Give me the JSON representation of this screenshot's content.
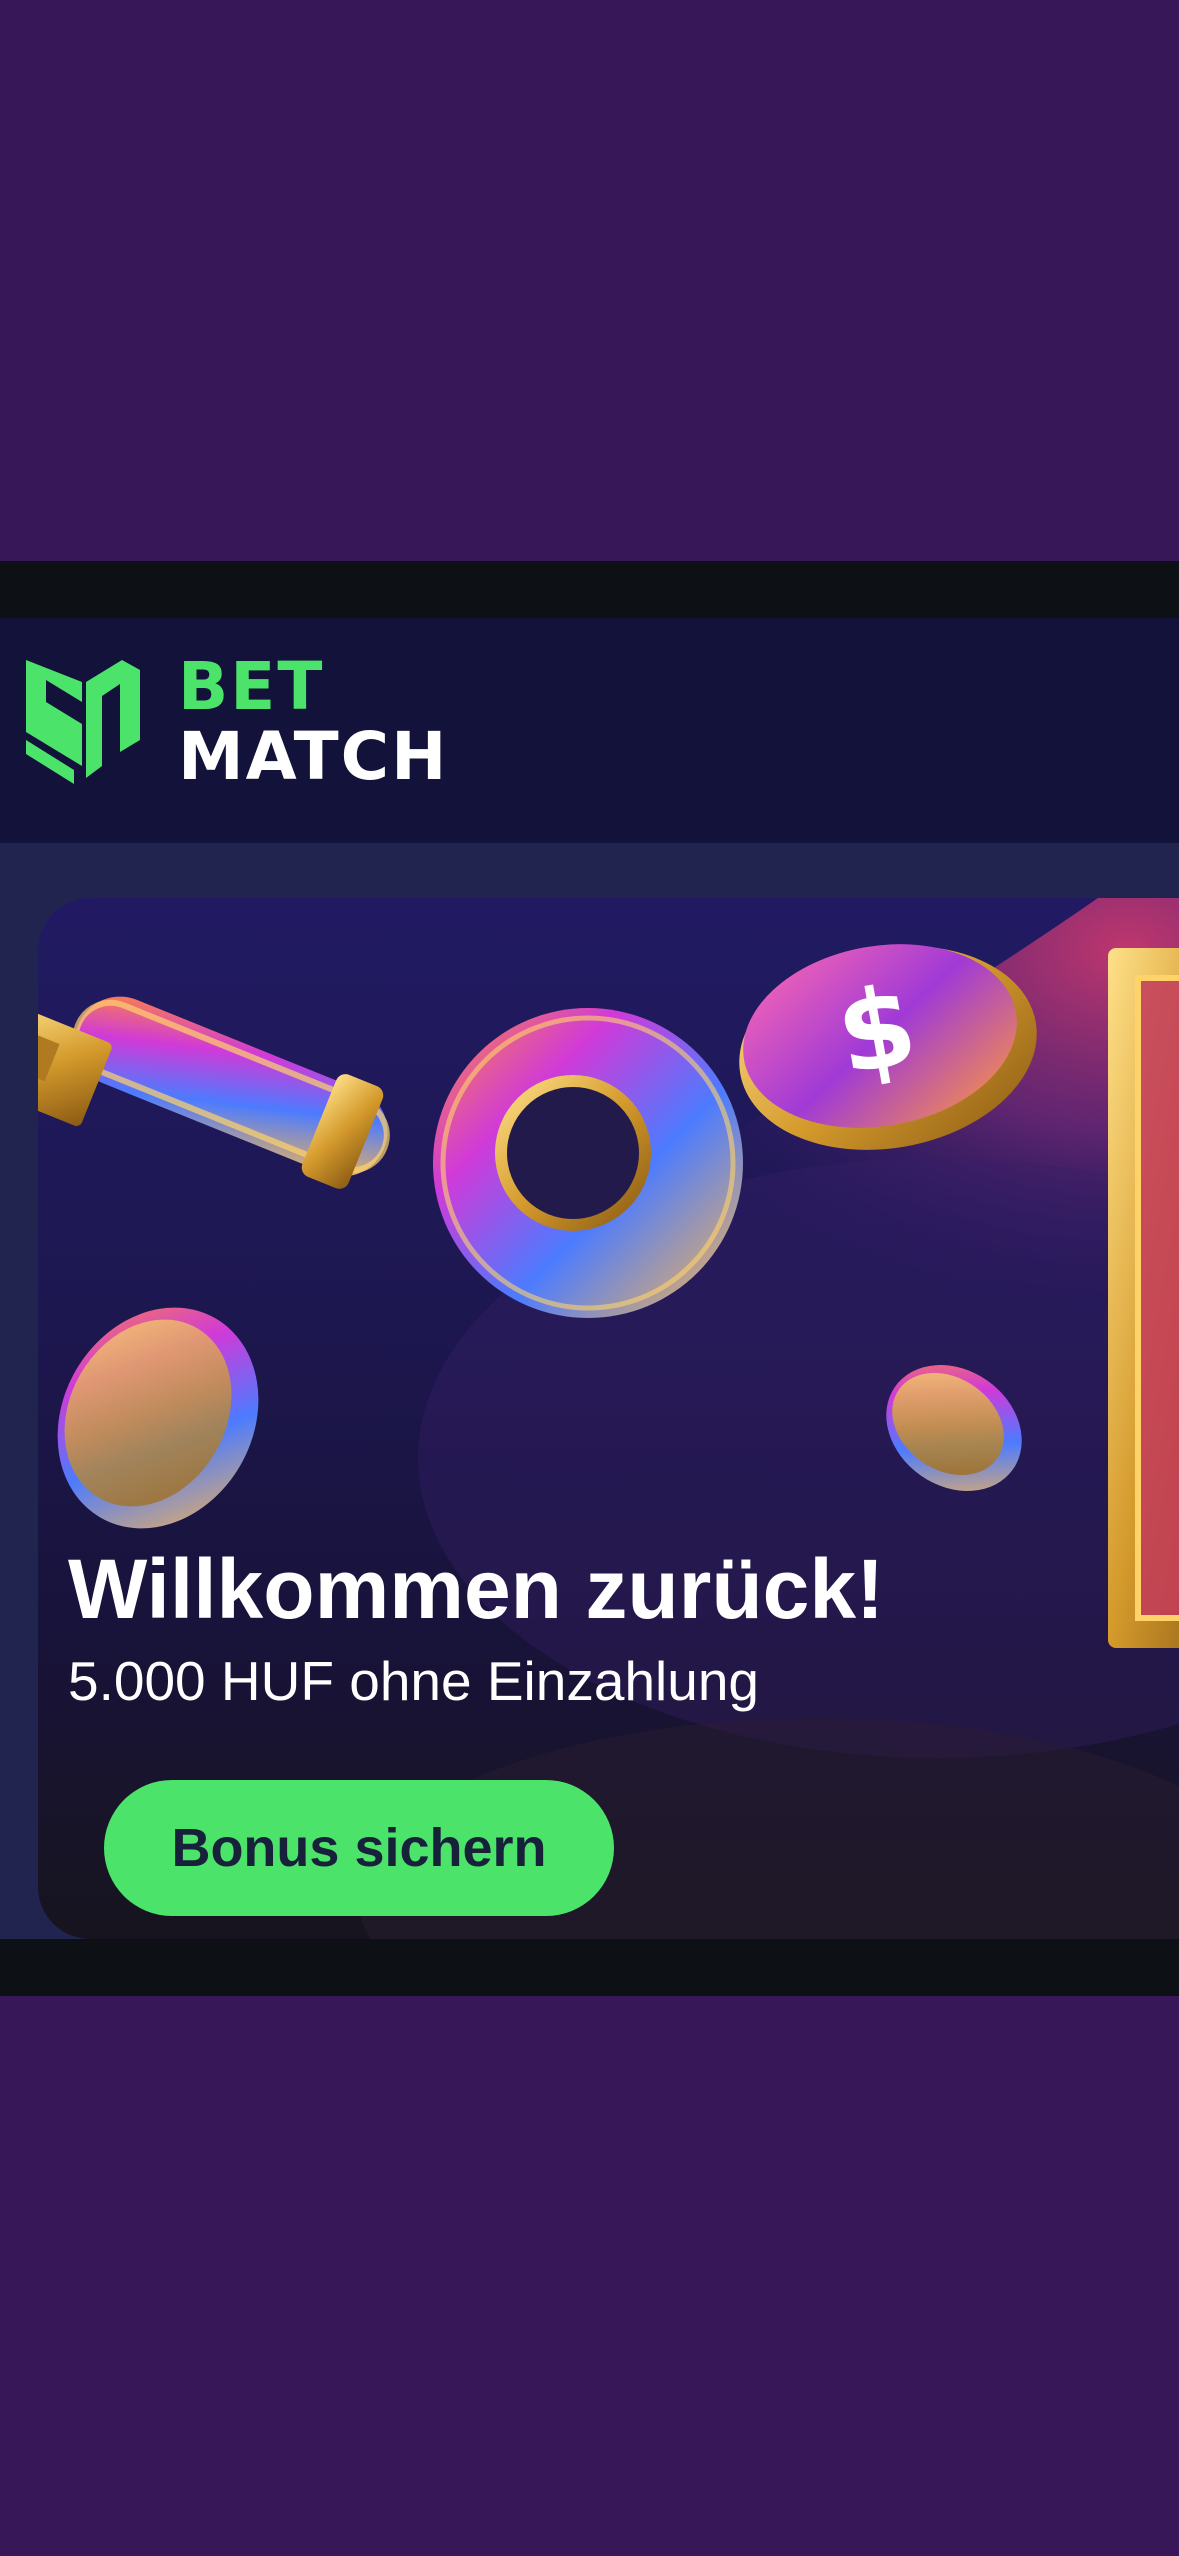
{
  "brand": {
    "line1": "BET",
    "line2": "MATCH",
    "green": "#4ce36b"
  },
  "banner": {
    "title": "Willkommen zurück!",
    "subtitle": "5.000 HUF ohne Einzahlung",
    "button_label": "Bonus sichern",
    "art": [
      "key-icon",
      "dollar-coin-icon",
      "coin-icon",
      "vault-door-icon"
    ]
  },
  "colors": {
    "page_background": "#371758",
    "header_background": "#13123a",
    "accent": "#4ce36b"
  }
}
